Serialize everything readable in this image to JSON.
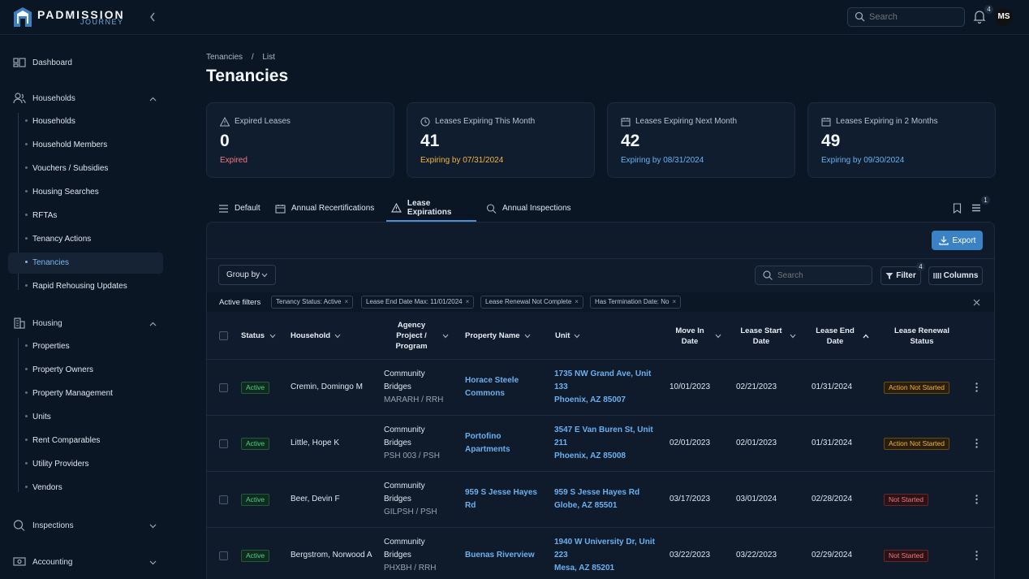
{
  "brand": {
    "name": "PADMISSION",
    "sub": "JOURNEY"
  },
  "topbar": {
    "search_placeholder": "Search",
    "notif_count": "4",
    "avatar_initials": "MS"
  },
  "colors": {
    "accent": "#3b82c4",
    "link": "#6ab0f0",
    "expired": "#f07a7f",
    "warning": "#f2b441",
    "success": "#4fd08a"
  },
  "sidebar": {
    "dashboard": "Dashboard",
    "households": {
      "label": "Households",
      "items": [
        "Households",
        "Household Members",
        "Vouchers / Subsidies",
        "Housing Searches",
        "RFTAs",
        "Tenancy Actions",
        "Tenancies",
        "Rapid Rehousing Updates"
      ]
    },
    "housing": {
      "label": "Housing",
      "items": [
        "Properties",
        "Property Owners",
        "Property Management",
        "Units",
        "Rent Comparables",
        "Utility Providers",
        "Vendors"
      ]
    },
    "inspections": "Inspections",
    "accounting": "Accounting",
    "active_item": "Tenancies"
  },
  "breadcrumb": {
    "root": "Tenancies",
    "sep": "/",
    "current": "List"
  },
  "page_title": "Tenancies",
  "cards": [
    {
      "label": "Expired Leases",
      "value": "0",
      "sub": "Expired",
      "icon": "warning-icon"
    },
    {
      "label": "Leases Expiring This Month",
      "value": "41",
      "sub": "Expiring by 07/31/2024",
      "icon": "clock-icon"
    },
    {
      "label": "Leases Expiring Next Month",
      "value": "42",
      "sub": "Expiring by 08/31/2024",
      "icon": "calendar-icon"
    },
    {
      "label": "Leases Expiring in 2 Months",
      "value": "49",
      "sub": "Expiring by 09/30/2024",
      "icon": "calendar-icon"
    }
  ],
  "tabs": [
    {
      "label": "Default",
      "icon": "list-icon"
    },
    {
      "label": "Annual Recertifications",
      "icon": "calendar-icon"
    },
    {
      "label": "Lease Expirations",
      "icon": "warning-icon",
      "active": true
    },
    {
      "label": "Annual Inspections",
      "icon": "search-icon"
    }
  ],
  "views_count": "1",
  "toolbar": {
    "export": "Export",
    "group_by": "Group by",
    "search_placeholder": "Search",
    "filter": "Filter",
    "filter_count": "4",
    "columns": "Columns"
  },
  "active_filters": {
    "label": "Active filters",
    "chips": [
      "Tenancy Status: Active",
      "Lease End Date Max: 11/01/2024",
      "Lease Renewal Not Complete",
      "Has Termination Date: No"
    ]
  },
  "columns": {
    "status": "Status",
    "household": "Household",
    "agency": [
      "Agency",
      "Project /",
      "Program"
    ],
    "property": "Property Name",
    "unit": "Unit",
    "move_in": [
      "Move In",
      "Date"
    ],
    "lease_start": [
      "Lease Start",
      "Date"
    ],
    "lease_end": [
      "Lease End",
      "Date"
    ],
    "renewal": [
      "Lease Renewal",
      "Status"
    ]
  },
  "rows": [
    {
      "status": "Active",
      "household": "Cremin, Domingo M",
      "agency": [
        "Community",
        "Bridges",
        "MARARH / RRH"
      ],
      "property": [
        "Horace Steele",
        "Commons"
      ],
      "unit": [
        "1735 NW Grand Ave, Unit",
        "133",
        "Phoenix, AZ 85007"
      ],
      "move_in": "10/01/2023",
      "lease_start": "02/21/2023",
      "lease_end": "01/31/2024",
      "renewal": "Action Not Started",
      "renewal_kind": "action"
    },
    {
      "status": "Active",
      "household": "Little, Hope K",
      "agency": [
        "Community",
        "Bridges",
        "PSH 003 / PSH"
      ],
      "property": [
        "Portofino",
        "Apartments"
      ],
      "unit": [
        "3547 E Van Buren St, Unit",
        "211",
        "Phoenix, AZ 85008"
      ],
      "move_in": "02/01/2023",
      "lease_start": "02/01/2023",
      "lease_end": "01/31/2024",
      "renewal": "Action Not Started",
      "renewal_kind": "action"
    },
    {
      "status": "Active",
      "household": "Beer, Devin F",
      "agency": [
        "Community",
        "Bridges",
        "GILPSH / PSH"
      ],
      "property": [
        "959 S Jesse Hayes",
        "Rd"
      ],
      "unit": [
        "959 S Jesse Hayes Rd",
        "Globe, AZ 85501",
        ""
      ],
      "move_in": "03/17/2023",
      "lease_start": "03/01/2024",
      "lease_end": "02/28/2024",
      "renewal": "Not Started",
      "renewal_kind": "not"
    },
    {
      "status": "Active",
      "household": "Bergstrom, Norwood A",
      "agency": [
        "Community",
        "Bridges",
        "PHXBH / RRH"
      ],
      "property": [
        "Buenas Riverview",
        ""
      ],
      "unit": [
        "1940 W University Dr, Unit",
        "223",
        "Mesa, AZ 85201"
      ],
      "move_in": "03/22/2023",
      "lease_start": "03/22/2023",
      "lease_end": "02/29/2024",
      "renewal": "Not Started",
      "renewal_kind": "not"
    }
  ]
}
